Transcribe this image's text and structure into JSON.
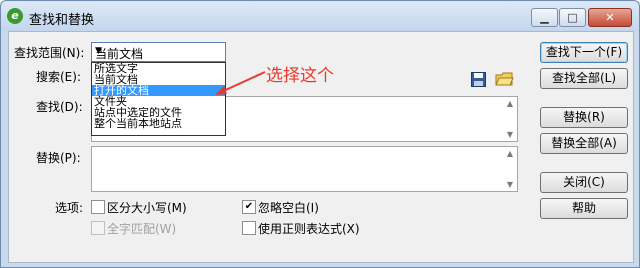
{
  "window": {
    "title": "查找和替换",
    "app_icon_glyph": "e",
    "minimize_glyph": "▁",
    "maximize_glyph": "□",
    "close_glyph": "✕"
  },
  "form": {
    "scope_label": "查找范围(N):",
    "scope_value": "当前文档",
    "scope_options": [
      "所选文字",
      "当前文档",
      "打开的文档",
      "文件夹",
      "站点中选定的文件",
      "整个当前本地站点"
    ],
    "search_label": "搜索(E):",
    "find_label": "查找(D):",
    "replace_label": "替换(P):",
    "find_value": "",
    "replace_value": "",
    "options_label": "选项:",
    "options": [
      {
        "label": "区分大小写(M)",
        "checked": false,
        "enabled": true
      },
      {
        "label": "全字匹配(W)",
        "checked": false,
        "enabled": false
      },
      {
        "label": "忽略空白(I)",
        "checked": true,
        "enabled": true
      },
      {
        "label": "使用正则表达式(X)",
        "checked": false,
        "enabled": true
      }
    ]
  },
  "icons": {
    "save": "save-icon",
    "open": "open-folder-icon"
  },
  "buttons": {
    "find_next": "查找下一个(F)",
    "find_all": "查找全部(L)",
    "replace": "替换(R)",
    "replace_all": "替换全部(A)",
    "close": "关闭(C)",
    "help": "帮助"
  },
  "annotation": {
    "text": "选择这个",
    "color": "#e8392e"
  }
}
